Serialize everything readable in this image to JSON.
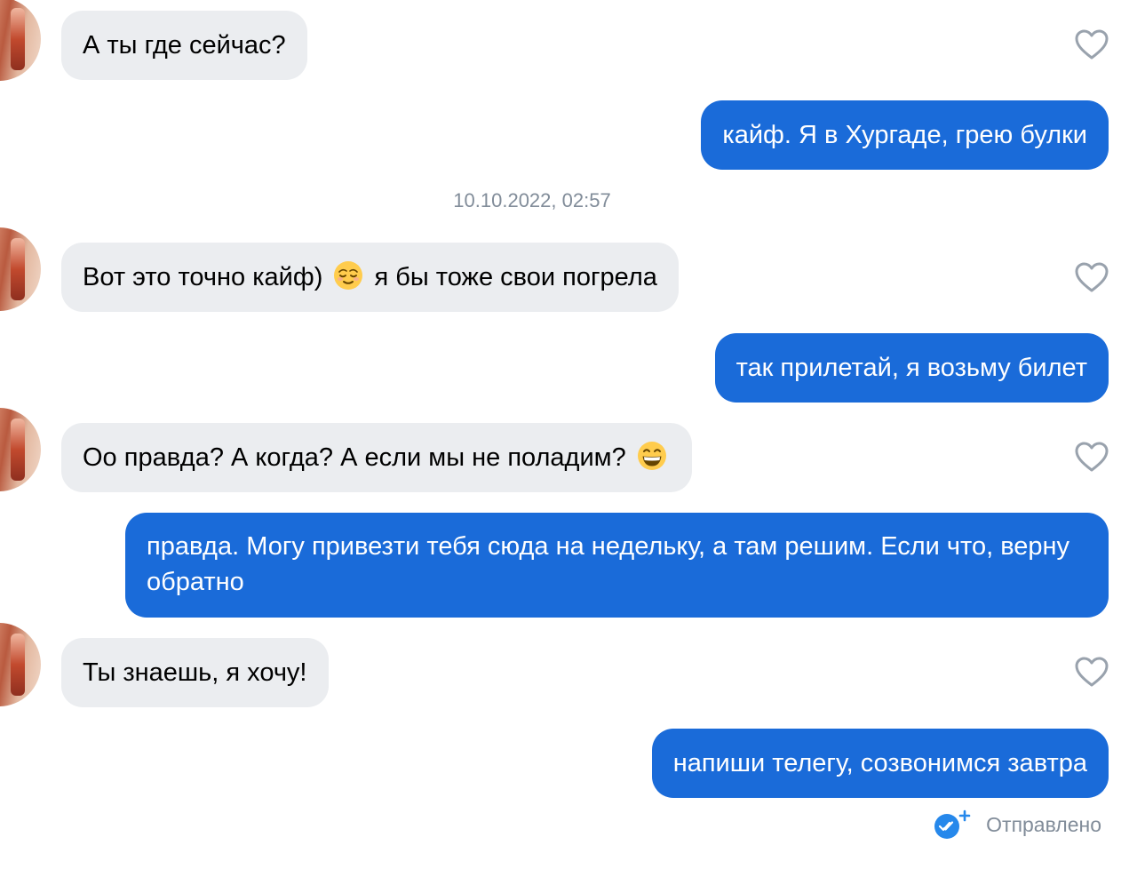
{
  "messages": [
    {
      "direction": "incoming",
      "text": "А ты где сейчас?"
    },
    {
      "direction": "outgoing",
      "text": "кайф. Я в Хургаде, грею булки"
    },
    {
      "direction": "incoming",
      "text_before": "Вот это точно кайф)",
      "emoji": "relieved-face",
      "text_after": "я бы тоже свои погрела"
    },
    {
      "direction": "outgoing",
      "text": "так прилетай, я возьму билет"
    },
    {
      "direction": "incoming",
      "text_before": "Оо правда? А когда? А если мы не поладим?",
      "emoji": "grinning-face"
    },
    {
      "direction": "outgoing",
      "text": "правда. Могу привезти тебя сюда на недельку, а там решим. Если что, верну обратно"
    },
    {
      "direction": "incoming",
      "text": "Ты знаешь, я хочу!"
    },
    {
      "direction": "outgoing",
      "text": "напиши телегу, созвонимся завтра"
    }
  ],
  "date_separator": "10.10.2022, 02:57",
  "status": {
    "label": "Отправлено",
    "icon": "double-check-plus-icon"
  },
  "colors": {
    "outgoing_bubble": "#1a6bd9",
    "incoming_bubble": "#ebedf0",
    "meta_text": "#818c99",
    "heart": "#99a2ad"
  }
}
